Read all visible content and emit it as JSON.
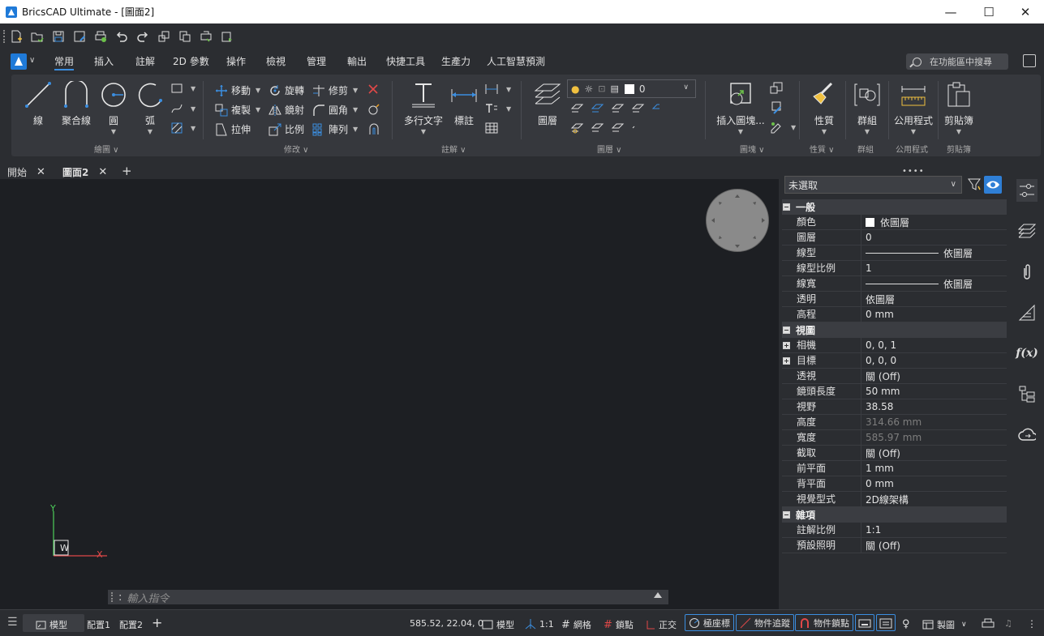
{
  "window": {
    "title": "BricsCAD Ultimate - [圖面2]",
    "minimize": "—",
    "maximize": "☐",
    "close": "✕"
  },
  "ribbon_tabs": [
    "常用",
    "插入",
    "註解",
    "2D 參數",
    "操作",
    "檢視",
    "管理",
    "輸出",
    "快捷工具",
    "生產力",
    "人工智慧預測"
  ],
  "search": {
    "placeholder": "在功能區中搜尋"
  },
  "ribbon": {
    "draw": {
      "line": "線",
      "polyline": "聚合線",
      "circle": "圓",
      "arc": "弧",
      "panel": "繪圖"
    },
    "modify": {
      "move": "移動",
      "copy": "複製",
      "stretch": "拉伸",
      "rotate": "旋轉",
      "mirror": "鏡射",
      "scale": "比例",
      "trim": "修剪",
      "fillet": "圓角",
      "array": "陣列",
      "panel": "修改"
    },
    "annotation": {
      "mtext": "多行文字",
      "dimension": "標註",
      "panel": "註解"
    },
    "layers": {
      "layer": "圖層",
      "current_layer": "0",
      "panel": "圖層"
    },
    "block": {
      "insert": "插入圖塊...",
      "panel": "圖塊"
    },
    "properties": {
      "match": "性質",
      "panel": "性質"
    },
    "groups": {
      "group": "群組",
      "panel": "群組"
    },
    "utilities": {
      "utilities": "公用程式",
      "panel": "公用程式"
    },
    "clipboard": {
      "clipboard": "剪貼簿",
      "panel": "剪貼簿"
    }
  },
  "doc_tabs": [
    {
      "label": "開始"
    },
    {
      "label": "圖面2"
    }
  ],
  "canvas": {
    "ucs_x": "X",
    "ucs_y": "Y",
    "ucs_w": "W"
  },
  "command": {
    "placeholder": "輸入指令"
  },
  "properties_panel": {
    "selection": "未選取",
    "groups": [
      {
        "title": "一般",
        "rows": [
          {
            "key": "顏色",
            "value": "依圖層"
          },
          {
            "key": "圖層",
            "value": "0"
          },
          {
            "key": "線型",
            "value": "依圖層"
          },
          {
            "key": "線型比例",
            "value": "1"
          },
          {
            "key": "線寬",
            "value": "依圖層"
          },
          {
            "key": "透明",
            "value": "依圖層"
          },
          {
            "key": "高程",
            "value": "0 mm"
          }
        ]
      },
      {
        "title": "視圖",
        "rows": [
          {
            "key": "相機",
            "value": "0, 0, 1"
          },
          {
            "key": "目標",
            "value": "0, 0, 0"
          },
          {
            "key": "透視",
            "value": "關 (Off)"
          },
          {
            "key": "鏡頭長度",
            "value": "50 mm"
          },
          {
            "key": "視野",
            "value": "38.58"
          },
          {
            "key": "高度",
            "value": "314.66 mm"
          },
          {
            "key": "寬度",
            "value": "585.97 mm"
          },
          {
            "key": "截取",
            "value": "關 (Off)"
          },
          {
            "key": "前平面",
            "value": "1 mm"
          },
          {
            "key": "背平面",
            "value": "0 mm"
          },
          {
            "key": "視覺型式",
            "value": "2D線架構"
          }
        ]
      },
      {
        "title": "雜項",
        "rows": [
          {
            "key": "註解比例",
            "value": "1:1"
          },
          {
            "key": "預設照明",
            "value": "關 (Off)"
          }
        ]
      }
    ]
  },
  "status": {
    "model_tab": "模型",
    "layout1": "配置1",
    "layout2": "配置2",
    "coords": "585.52, 22.04, 0",
    "model": "模型",
    "scale": "1:1",
    "grid": "網格",
    "snap": "鎖點",
    "ortho": "正交",
    "polar": "極座標",
    "otrack": "物件追蹤",
    "osnap": "物件鎖點",
    "workspace": "製圖"
  },
  "colors": {
    "accent": "#3b8ee0",
    "canvas": "#1d1f23",
    "panel": "#36383d"
  }
}
